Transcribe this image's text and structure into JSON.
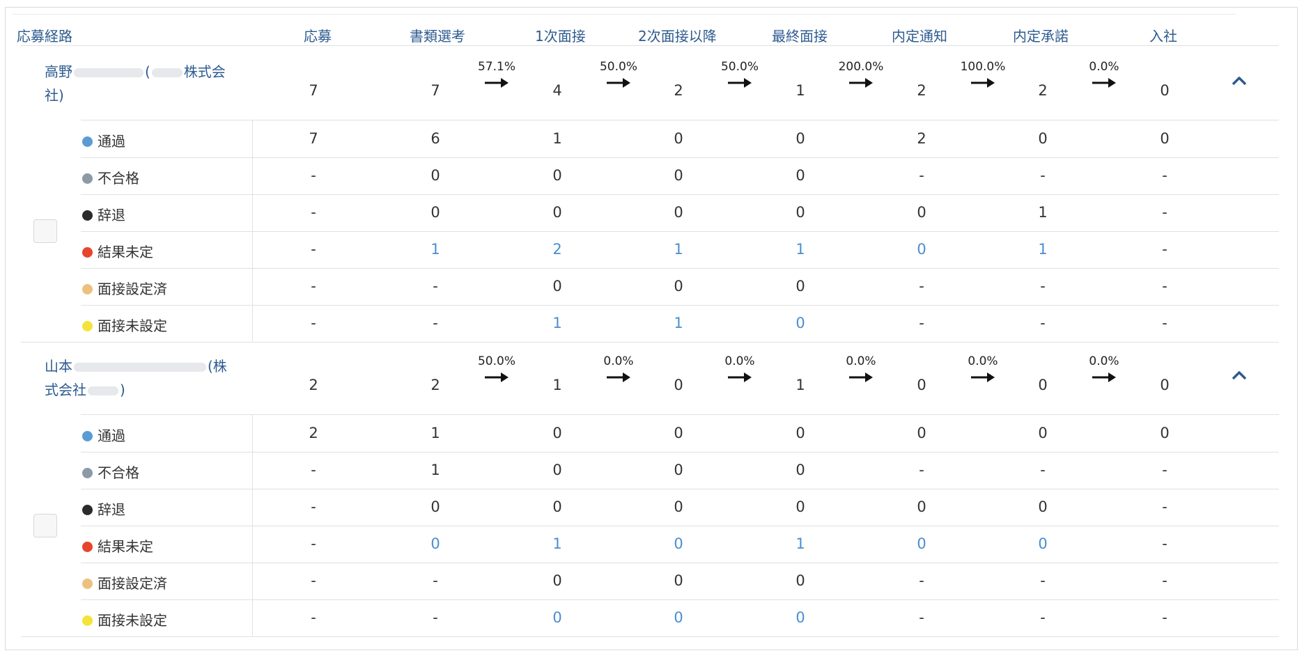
{
  "headers": [
    "応募経路",
    "応募",
    "書類選考",
    "1次面接",
    "2次面接以降",
    "最終面接",
    "内定通知",
    "内定承諾",
    "入社"
  ],
  "colors": {
    "header_text": "#2d5a8f",
    "link_value": "#4a8ed0",
    "text": "#333333",
    "border": "#e0e0e0",
    "status_dots": {
      "通過": "#5b9bd5",
      "不合格": "#8c9aa6",
      "辞退": "#2b2b2b",
      "結果未定": "#e8452c",
      "面接設定済": "#ecc17e",
      "面接未設定": "#f4e43a"
    }
  },
  "groups": [
    {
      "source_line1_a": "高野",
      "source_line1_b": "(",
      "source_line1_c": "株式会",
      "source_line2": "社)",
      "summary": [
        "7",
        "7",
        "4",
        "2",
        "1",
        "2",
        "2",
        "0"
      ],
      "rates": [
        "57.1%",
        "50.0%",
        "50.0%",
        "200.0%",
        "100.0%",
        "0.0%"
      ],
      "expand_icon": "chevron-up-icon",
      "rows": [
        {
          "status": "通過",
          "values": [
            "7",
            "6",
            "1",
            "0",
            "0",
            "2",
            "0",
            "0"
          ],
          "links": []
        },
        {
          "status": "不合格",
          "values": [
            "-",
            "0",
            "0",
            "0",
            "0",
            "-",
            "-",
            "-"
          ],
          "links": []
        },
        {
          "status": "辞退",
          "values": [
            "-",
            "0",
            "0",
            "0",
            "0",
            "0",
            "1",
            "-"
          ],
          "links": []
        },
        {
          "status": "結果未定",
          "values": [
            "-",
            "1",
            "2",
            "1",
            "1",
            "0",
            "1",
            "-"
          ],
          "links": [
            1,
            2,
            3,
            4,
            5,
            6
          ]
        },
        {
          "status": "面接設定済",
          "values": [
            "-",
            "-",
            "0",
            "0",
            "0",
            "-",
            "-",
            "-"
          ],
          "links": []
        },
        {
          "status": "面接未設定",
          "values": [
            "-",
            "-",
            "1",
            "1",
            "0",
            "-",
            "-",
            "-"
          ],
          "links": [
            2,
            3,
            4
          ]
        }
      ]
    },
    {
      "source_line1_a": "山本",
      "source_line1_b": "(株",
      "source_line1_c": "",
      "source_line2": "式会社",
      "source_line2_end": ")",
      "summary": [
        "2",
        "2",
        "1",
        "0",
        "1",
        "0",
        "0",
        "0"
      ],
      "rates": [
        "50.0%",
        "0.0%",
        "0.0%",
        "0.0%",
        "0.0%",
        "0.0%"
      ],
      "expand_icon": "chevron-up-icon",
      "rows": [
        {
          "status": "通過",
          "values": [
            "2",
            "1",
            "0",
            "0",
            "0",
            "0",
            "0",
            "0"
          ],
          "links": []
        },
        {
          "status": "不合格",
          "values": [
            "-",
            "1",
            "0",
            "0",
            "0",
            "-",
            "-",
            "-"
          ],
          "links": []
        },
        {
          "status": "辞退",
          "values": [
            "-",
            "0",
            "0",
            "0",
            "0",
            "0",
            "0",
            "-"
          ],
          "links": []
        },
        {
          "status": "結果未定",
          "values": [
            "-",
            "0",
            "1",
            "0",
            "1",
            "0",
            "0",
            "-"
          ],
          "links": [
            1,
            2,
            3,
            4,
            5,
            6
          ]
        },
        {
          "status": "面接設定済",
          "values": [
            "-",
            "-",
            "0",
            "0",
            "0",
            "-",
            "-",
            "-"
          ],
          "links": []
        },
        {
          "status": "面接未設定",
          "values": [
            "-",
            "-",
            "0",
            "0",
            "0",
            "-",
            "-",
            "-"
          ],
          "links": [
            2,
            3,
            4
          ]
        }
      ]
    }
  ]
}
